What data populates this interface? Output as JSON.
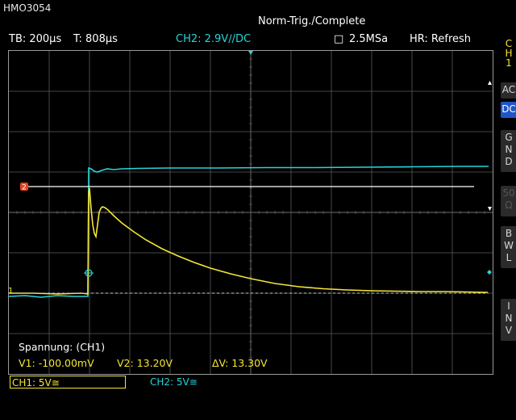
{
  "header": {
    "model": "HMO3054",
    "status": "Norm-Trig./Complete"
  },
  "topbar": {
    "timebase": "TB: 200µs",
    "trigger_time": "T: 808µs",
    "ch2_setting": "CH2: 2.9V∕/DC",
    "sample_icon": "□",
    "sample_rate": "2.5MSa",
    "acq_mode": "HR: Refresh"
  },
  "side_panel": {
    "channel_tag": "C\nH\n1",
    "buttons": [
      {
        "label": "AC",
        "state": "normal"
      },
      {
        "label": "DC",
        "state": "active"
      },
      {
        "label": "G\nN\nD",
        "state": "normal"
      },
      {
        "label": "50\nΩ",
        "state": "dim"
      },
      {
        "label": "B\nW\nL",
        "state": "normal"
      },
      {
        "label": "I\nN\nV",
        "state": "normal"
      }
    ]
  },
  "measurement": {
    "title": "Spannung: (CH1)",
    "v1": "V1: -100.00mV",
    "v2": "V2: 13.20V",
    "delta": "ΔV: 13.30V"
  },
  "markers": {
    "ch2_ref": "2",
    "ch1_ref": "1"
  },
  "bottom_bar": {
    "ch1": "CH1: 5V≅",
    "ch2": "CH2: 5V≅"
  },
  "colors": {
    "ch1": "#f5e633",
    "ch2": "#27d4d8",
    "grid": "#5a5a5a",
    "cursor": "#ffffff",
    "marker": "#e8401c"
  }
}
